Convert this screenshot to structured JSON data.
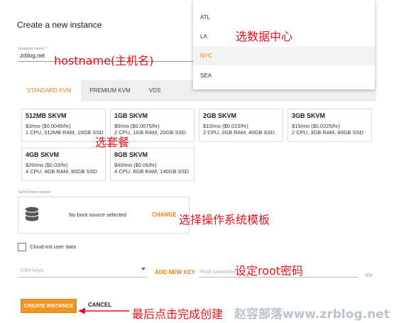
{
  "dialog": {
    "title": "Create a new instance"
  },
  "hostname": {
    "label": "Instance name *",
    "value": "zrblog.net"
  },
  "tabs": [
    {
      "label": "STANDARD KVM",
      "active": true
    },
    {
      "label": "PREMIUM KVM",
      "active": false
    },
    {
      "label": "VDS",
      "active": false
    }
  ],
  "plans": [
    {
      "name": "512MB SKVM",
      "price": "$3/mo ($0.0045/hr)",
      "specs": "1 CPU, 512MB RAM, 10GB SSD"
    },
    {
      "name": "1GB SKVM",
      "price": "$5/mo ($0.0075/hr)",
      "specs": "2 CPU, 1GB RAM, 20GB SSD"
    },
    {
      "name": "2GB SKVM",
      "price": "$10/mo ($0.015/hr)",
      "specs": "2 CPU, 2GB RAM, 40GB SSD"
    },
    {
      "name": "3GB SKVM",
      "price": "$15/mo ($0.0225/hr)",
      "specs": "2 CPU, 3GB RAM, 60GB SSD"
    },
    {
      "name": "4GB SKVM",
      "price": "$20/mo ($0.03/hr)",
      "specs": "4 CPU, 4GB RAM, 80GB SSD"
    },
    {
      "name": "8GB SKVM",
      "price": "$40/mo ($0.06/hr)",
      "specs": "4 CPU, 8GB RAM, 140GB SSD"
    }
  ],
  "boot": {
    "label": "Select boot source",
    "status": "No boot source selected",
    "change_label": "CHANGE",
    "icon": "database-icon"
  },
  "cloud_init": {
    "label": "Cloud-init user data",
    "checked": false
  },
  "ssh": {
    "placeholder": "SSH keys",
    "add_label": "ADD NEW KEY"
  },
  "root_password": {
    "placeholder": "Root password",
    "icon": "eye-icon"
  },
  "actions": {
    "create_label": "CREATE INSTANCE",
    "cancel_label": "CANCEL"
  },
  "datacenter_dropdown": {
    "options": [
      "ATL",
      "LA",
      "NYC",
      "SEA"
    ],
    "selected": "NYC"
  },
  "annotations": {
    "datacenter": "选数据中心",
    "hostname": "hostname(主机名)",
    "plan": "选套餐",
    "os": "选择操作系统模板",
    "root": "设定root密码",
    "finish": "最后点击完成创建"
  },
  "watermark": "赵容部落www.zrblog.net",
  "colors": {
    "accent": "#e8821b",
    "annotation": "#e8111b",
    "button": "#f0951e"
  }
}
